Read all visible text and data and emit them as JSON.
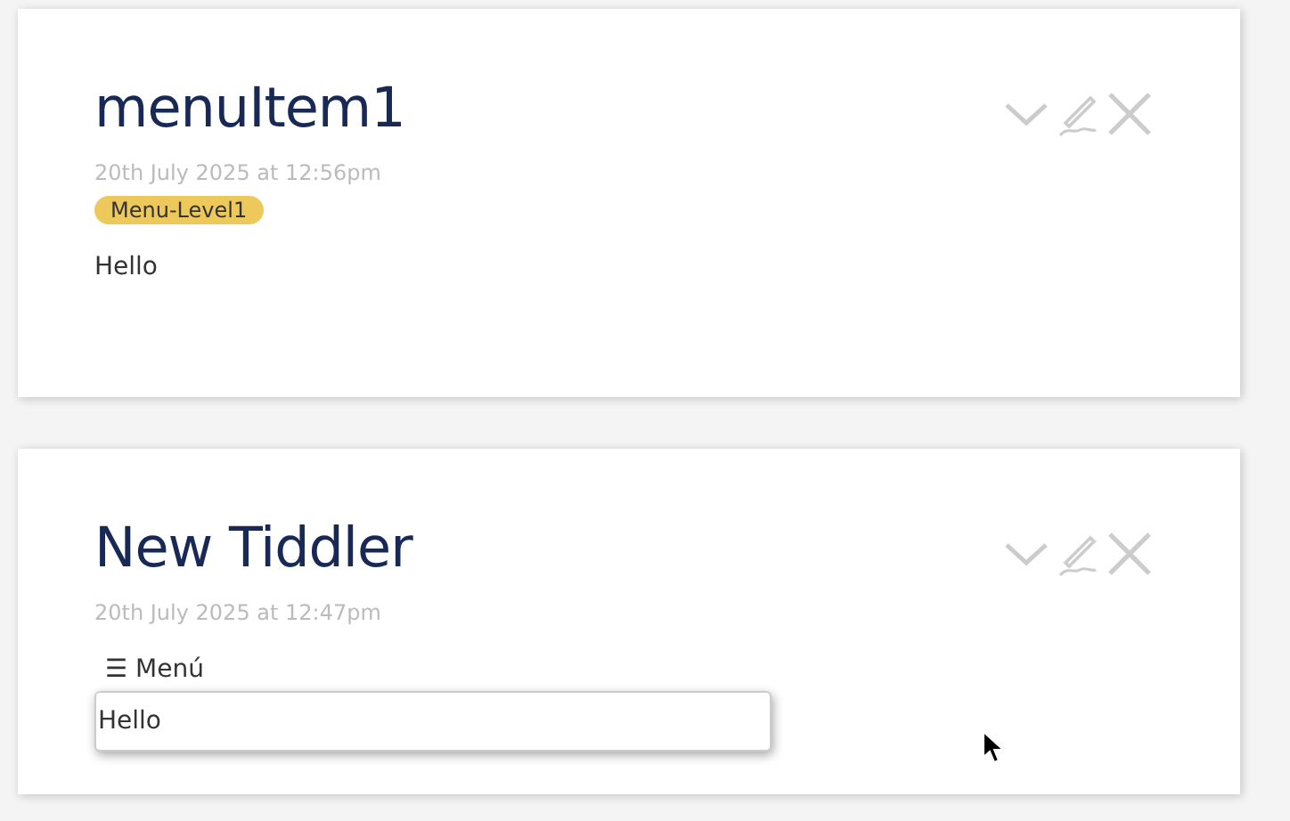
{
  "tiddlers": [
    {
      "title": "menuItem1",
      "date": "20th July 2025 at 12:56pm",
      "tags": [
        {
          "label": "Menu-Level1",
          "color": "#ecc95a"
        }
      ],
      "body": "Hello"
    },
    {
      "title": "New Tiddler",
      "date": "20th July 2025 at 12:47pm",
      "menu": {
        "label": "☰ Menú",
        "expanded": true,
        "items": [
          "Hello"
        ]
      }
    }
  ]
}
